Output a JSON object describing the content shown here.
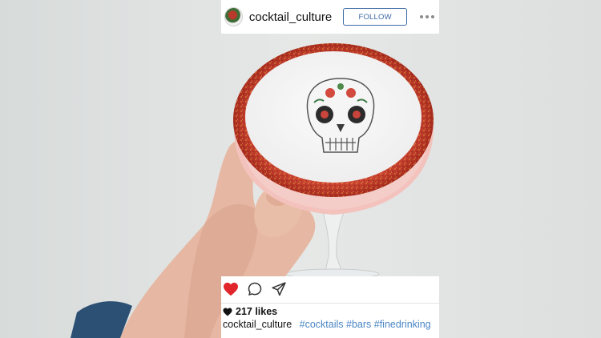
{
  "post": {
    "username": "cocktail_culture",
    "follow_label": "FOLLOW",
    "likes_text": "217 likes",
    "caption_user": "cocktail_culture",
    "caption_tags": "#cocktails #bars #finedrinking"
  },
  "icons": {
    "avatar": "avatar-image",
    "more": "more-options-icon",
    "like": "heart-icon",
    "comment": "comment-icon",
    "share": "send-icon",
    "likes": "small-heart-icon"
  },
  "colors": {
    "link_blue": "#4a86c5",
    "follow_blue": "#3d6aa6",
    "heart_red": "#e0262b",
    "rim_red": "#c0392b"
  }
}
